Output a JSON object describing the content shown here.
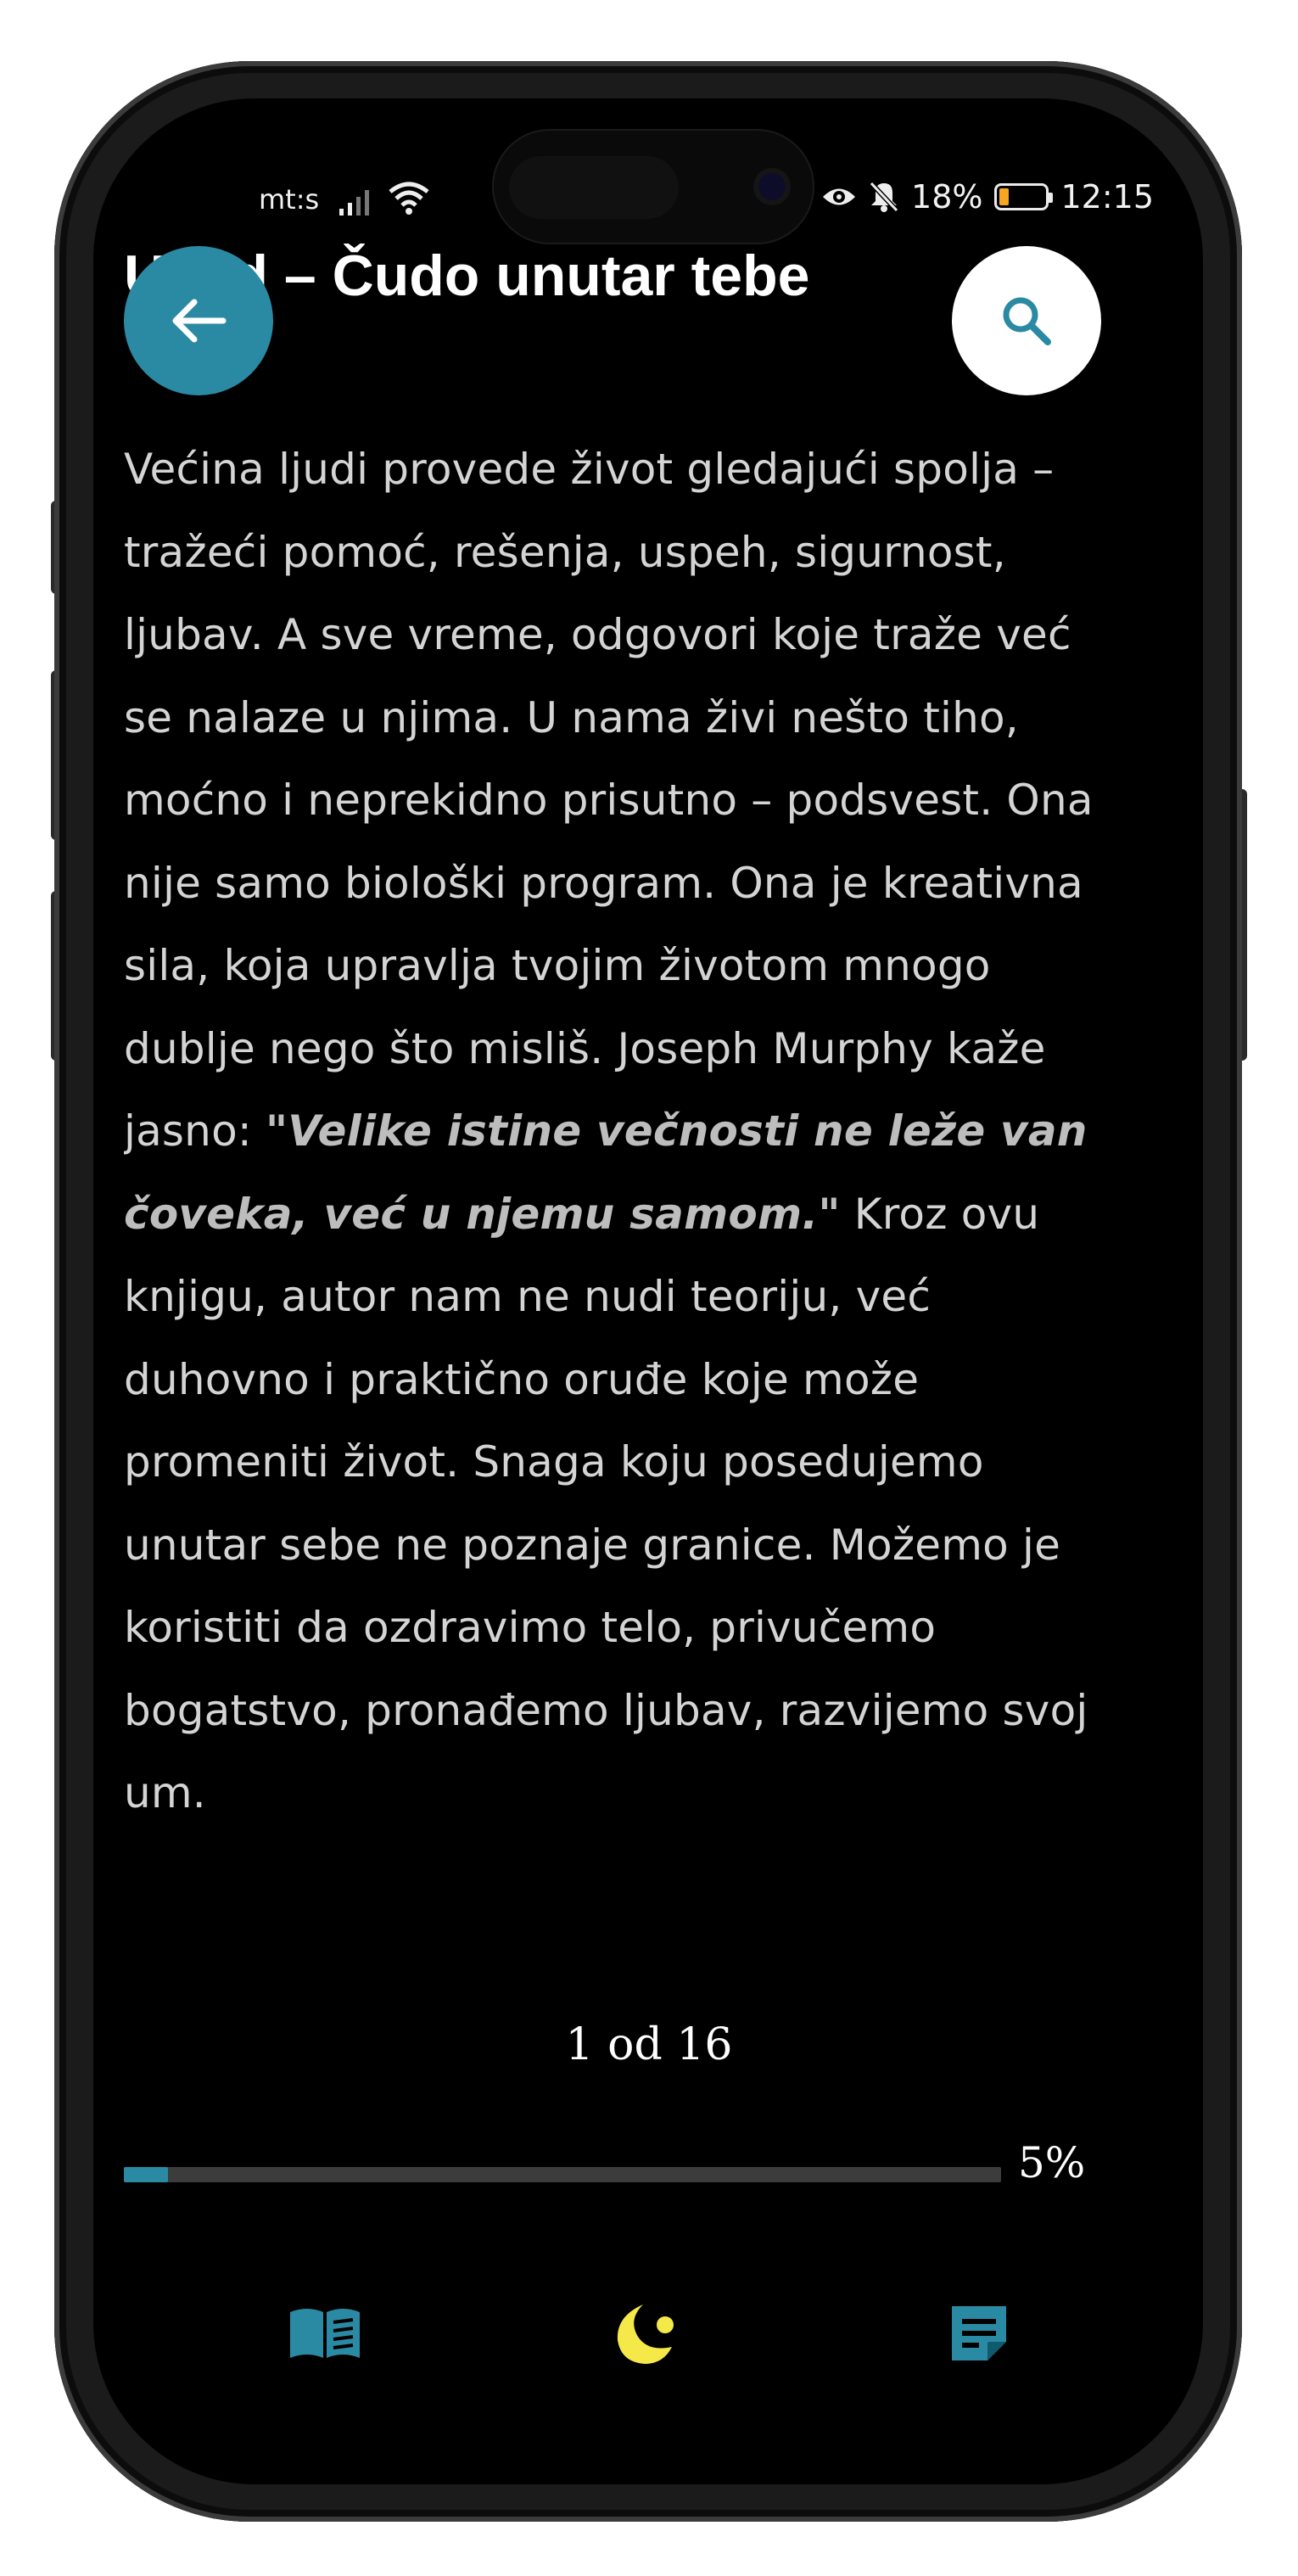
{
  "status_bar": {
    "carrier": "mt:s",
    "battery_percent": "18%",
    "battery_level": 0.18,
    "time": "12:15",
    "icons": [
      "signal-icon",
      "wifi-icon",
      "camera-icon",
      "eye-icon",
      "bell-off-icon",
      "battery-icon"
    ]
  },
  "header": {
    "title": "Uvod – Čudo unutar tebe",
    "back_icon": "arrow-left-icon",
    "search_icon": "search-icon"
  },
  "content": {
    "before_quote": "Većina ljudi provede život gledajući spolja – tražeći pomoć, rešenja, uspeh, sigurnost, ljubav. A sve vreme, odgovori koje traže već se nalaze u njima. U nama živi nešto tiho, moćno i neprekidno prisutno – podsvest. Ona nije samo biološki program. Ona je kreativna sila, koja upravlja tvojim životom mnogo dublje nego što misliš. Joseph Murphy kaže jasno:",
    "quote": "\"Velike istine večnosti ne leže van čoveka, već u njemu samom.\"",
    "after_quote": " Kroz ovu knjigu, autor nam ne nudi teoriju, već duhovno i praktično oruđe koje može promeniti život. Snaga koju posedujemo unutar sebe ne poznaje granice. Možemo je koristiti da ozdravimo telo, privučemo bogatstvo, pronađemo ljubav, razvijemo svoj um."
  },
  "pagination": {
    "label": "1 od 16"
  },
  "progress": {
    "percent_label": "5%",
    "value": 0.05
  },
  "colors": {
    "accent": "#2b8aa3",
    "night_icon": "#f5e94a",
    "background": "#000000",
    "text": "#d4d4d4"
  },
  "tabbar": {
    "items": [
      "book-open-icon",
      "night-mode-icon",
      "notes-icon"
    ]
  }
}
